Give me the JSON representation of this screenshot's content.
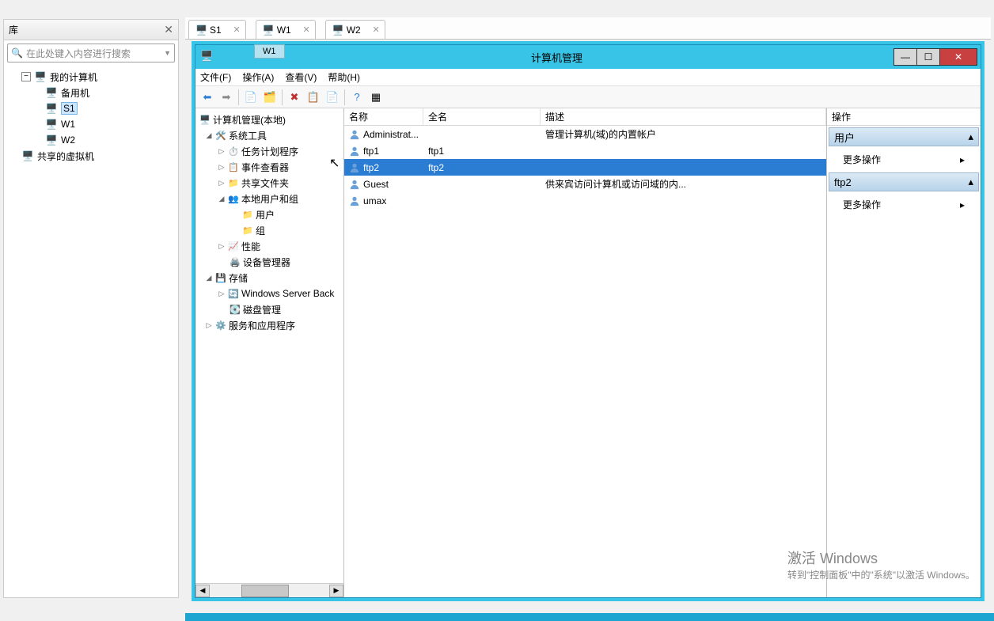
{
  "library": {
    "title": "库",
    "search_placeholder": "在此处键入内容进行搜索",
    "tree": {
      "root": "我的计算机",
      "backup": "备用机",
      "s1": "S1",
      "w1": "W1",
      "w2": "W2",
      "shared": "共享的虚拟机"
    }
  },
  "tabs": {
    "t1": "S1",
    "t2": "W1",
    "t3": "W2"
  },
  "inner_window": {
    "badge": "W1",
    "title": "计算机管理",
    "menu": {
      "file": "文件(F)",
      "action": "操作(A)",
      "view": "查看(V)",
      "help": "帮助(H)"
    },
    "tree": {
      "root": "计算机管理(本地)",
      "systools": "系统工具",
      "task": "任务计划程序",
      "event": "事件查看器",
      "share": "共享文件夹",
      "localusers": "本地用户和组",
      "users": "用户",
      "groups": "组",
      "perf": "性能",
      "devmgr": "设备管理器",
      "storage": "存储",
      "wsb": "Windows Server Back",
      "diskmgr": "磁盘管理",
      "services": "服务和应用程序"
    },
    "list": {
      "col_name": "名称",
      "col_fullname": "全名",
      "col_desc": "描述",
      "rows": [
        {
          "name": "Administrat...",
          "full": "",
          "desc": "管理计算机(域)的内置帐户",
          "selected": false
        },
        {
          "name": "ftp1",
          "full": "ftp1",
          "desc": "",
          "selected": false
        },
        {
          "name": "ftp2",
          "full": "ftp2",
          "desc": "",
          "selected": true
        },
        {
          "name": "Guest",
          "full": "",
          "desc": "供来宾访问计算机或访问域的内...",
          "selected": false
        },
        {
          "name": "umax",
          "full": "",
          "desc": "",
          "selected": false
        }
      ]
    },
    "actions": {
      "header": "操作",
      "section1": "用户",
      "more1": "更多操作",
      "section2": "ftp2",
      "more2": "更多操作"
    }
  },
  "watermark": {
    "line1": "激活 Windows",
    "line2": "转到\"控制面板\"中的\"系统\"以激活 Windows。"
  }
}
